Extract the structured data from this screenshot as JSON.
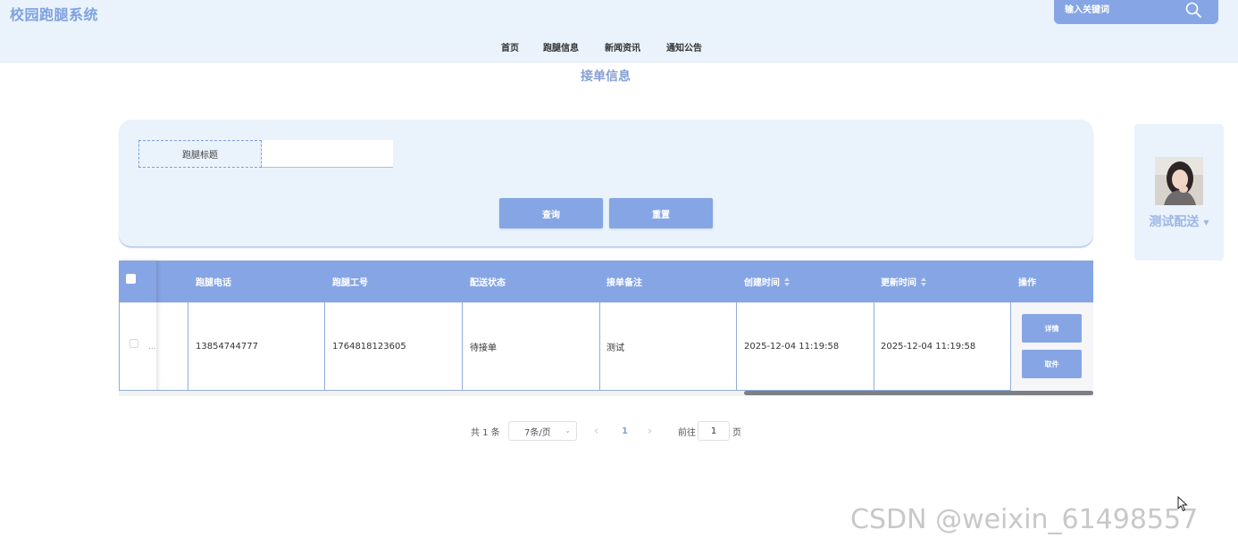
{
  "header": {
    "logo": "校园跑腿系统",
    "search_placeholder": "输入关键词",
    "nav": [
      "首页",
      "跑腿信息",
      "新闻资讯",
      "通知公告"
    ]
  },
  "page_heading": "接单信息",
  "filter": {
    "label": "跑腿标题",
    "value": "",
    "search_button": "查询",
    "reset_button": "重置"
  },
  "user": {
    "name": "测试配送"
  },
  "table": {
    "columns": [
      "跑腿电话",
      "跑腿工号",
      "配送状态",
      "接单备注",
      "创建时间",
      "更新时间",
      "操作"
    ],
    "rows": [
      {
        "ellipsis": "...",
        "phone": "13854744777",
        "runner_id": "1764818123605",
        "status": "待接单",
        "note": "测试",
        "created": "2025-12-04 11:19:58",
        "updated": "2025-12-04 11:19:58",
        "detail_button": "详情",
        "pickup_button": "取件"
      }
    ]
  },
  "pagination": {
    "total": "共 1 条",
    "page_size": "7条/页",
    "prev": "‹",
    "current_page": "1",
    "next": "›",
    "goto_label": "前往",
    "goto_value": "1",
    "page_unit": "页"
  },
  "watermark": "CSDN @weixin_61498557",
  "colors": {
    "accent": "#86a5e4",
    "header_bg": "#eaf3fc",
    "logo": "#7fa2de"
  }
}
